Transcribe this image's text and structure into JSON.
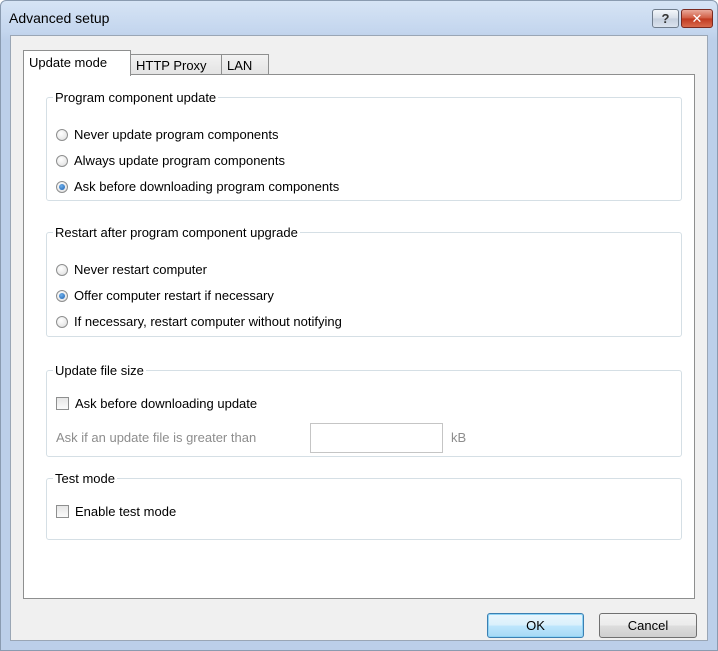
{
  "window": {
    "title": "Advanced setup",
    "help_glyph": "?",
    "close_glyph": "✕"
  },
  "tabs": [
    {
      "label": "Update mode",
      "active": true
    },
    {
      "label": "HTTP Proxy",
      "active": false
    },
    {
      "label": "LAN",
      "active": false
    }
  ],
  "program_update": {
    "legend": "Program component update",
    "options": [
      {
        "label": "Never update program components",
        "checked": false
      },
      {
        "label": "Always update program components",
        "checked": false
      },
      {
        "label": "Ask before downloading program components",
        "checked": true
      }
    ]
  },
  "restart": {
    "legend": "Restart after program component upgrade",
    "options": [
      {
        "label": "Never restart computer",
        "checked": false
      },
      {
        "label": "Offer computer restart if necessary",
        "checked": true
      },
      {
        "label": "If necessary, restart computer without notifying",
        "checked": false
      }
    ]
  },
  "file_size": {
    "legend": "Update file size",
    "ask_label": "Ask before downloading update",
    "ask_checked": false,
    "threshold_label": "Ask if an update file is greater than",
    "threshold_value": "",
    "unit": "kB"
  },
  "test_mode": {
    "legend": "Test mode",
    "enable_label": "Enable test mode",
    "enable_checked": false
  },
  "buttons": {
    "ok": "OK",
    "cancel": "Cancel"
  }
}
